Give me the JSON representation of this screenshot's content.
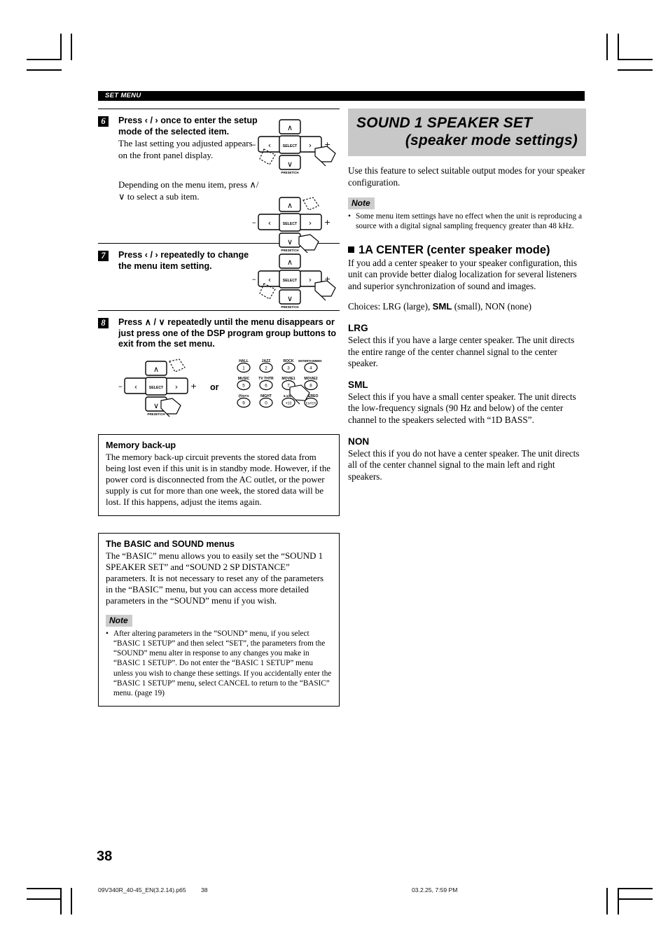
{
  "running_head": "SET MENU",
  "page_number": "38",
  "footer": {
    "file": "09V340R_40-45_EN(3.2.14).p65",
    "page": "38",
    "date": "03.2.25, 7:59 PM"
  },
  "colors": {
    "title_band": "#c8c8c8",
    "note_tag": "#cccccc",
    "rule": "#000000"
  },
  "steps": [
    {
      "number": "6",
      "heading": "Press ‹ / › once to enter the setup mode of the selected item.",
      "text": "The last setting you adjusted appears on the front panel display.",
      "text2": "Depending on the menu item, press ∧/∨ to select a sub item."
    },
    {
      "number": "7",
      "heading": "Press ‹ / › repeatedly to change the menu item setting."
    },
    {
      "number": "8",
      "heading": "Press ∧ / ∨ repeatedly until the menu disappears or just press one of the DSP program group buttons to exit from the set menu.",
      "or_label": "or"
    }
  ],
  "remote": {
    "select_label": "SELECT",
    "preset_label": "PRESET/CH",
    "minus": "–",
    "plus": "+",
    "up": "∧",
    "down": "∨",
    "left": "‹",
    "right": "›"
  },
  "dsp_keypad": {
    "rows": [
      [
        {
          "label": "HALL",
          "key": "1"
        },
        {
          "label": "JAZZ",
          "key": "2"
        },
        {
          "label": "ROCK",
          "key": "3"
        },
        {
          "label": "ENTERTAINMENT",
          "key": "4"
        }
      ],
      [
        {
          "label": "MUSIC",
          "key": "5"
        },
        {
          "label": "TV THTR",
          "key": "6"
        },
        {
          "label": "MOVIE1",
          "key": "7"
        },
        {
          "label": "MOVIE2",
          "key": "8"
        }
      ],
      [
        {
          "label": "Ⓓ /DTS",
          "key": "9"
        },
        {
          "label": "NIGHT",
          "key": "0"
        },
        {
          "label": "6.1/5.1",
          "key": "+10"
        },
        {
          "label": "STEREO",
          "key": "ENTER"
        }
      ]
    ]
  },
  "callouts": [
    {
      "title": "Memory back-up",
      "body": "The memory back-up circuit prevents the stored data from being lost even if this unit is in standby mode. However, if the power cord is disconnected from the AC outlet, or the power supply is cut for more than one week, the stored data will be lost. If this happens, adjust the items again."
    },
    {
      "title": "The BASIC and SOUND menus",
      "body": "The “BASIC” menu allows you to easily set the “SOUND 1 SPEAKER SET” and “SOUND 2 SP DISTANCE” parameters. It is not necessary to reset any of the parameters in the “BASIC” menu, but you can access more detailed parameters in the “SOUND” menu if you wish.",
      "note_tag": "Note",
      "note": "After altering parameters in the “SOUND” menu, if you select “BASIC 1 SETUP” and then select “SET”, the parameters from the “SOUND” menu alter in response to any changes you make in “BASIC 1 SETUP”. Do not enter the “BASIC 1 SETUP” menu unless you wish to change these settings. If you accidentally enter the “BASIC 1 SETUP” menu, select CANCEL to return to the “BASIC” menu. (page 19)"
    }
  ],
  "right": {
    "title_line1": "SOUND 1  SPEAKER SET",
    "title_line2": "(speaker mode settings)",
    "intro": "Use this feature to select suitable output modes for your speaker configuration.",
    "note_tag": "Note",
    "note": "Some menu item settings have no effect when the unit is reproducing a source with a digital signal sampling frequency greater than 48 kHz.",
    "section_heading": "1A CENTER (center speaker mode)",
    "section_intro": "If you add a center speaker to your speaker configuration, this unit can provide better dialog localization for several listeners and superior synchronization of sound and images.",
    "choices_prefix": "Choices: LRG (large), ",
    "choices_bold": "SML",
    "choices_suffix": " (small), NON (none)",
    "options": [
      {
        "name": "LRG",
        "desc": "Select this if you have a large center speaker. The unit directs the entire range of the center channel signal to the center speaker."
      },
      {
        "name": "SML",
        "desc": "Select this if you have a small center speaker. The unit directs the low-frequency signals (90 Hz and below) of the center channel to the speakers selected with “1D BASS”."
      },
      {
        "name": "NON",
        "desc": "Select this if you do not have a center speaker. The unit directs all of the center channel signal to the main left and right speakers."
      }
    ]
  }
}
